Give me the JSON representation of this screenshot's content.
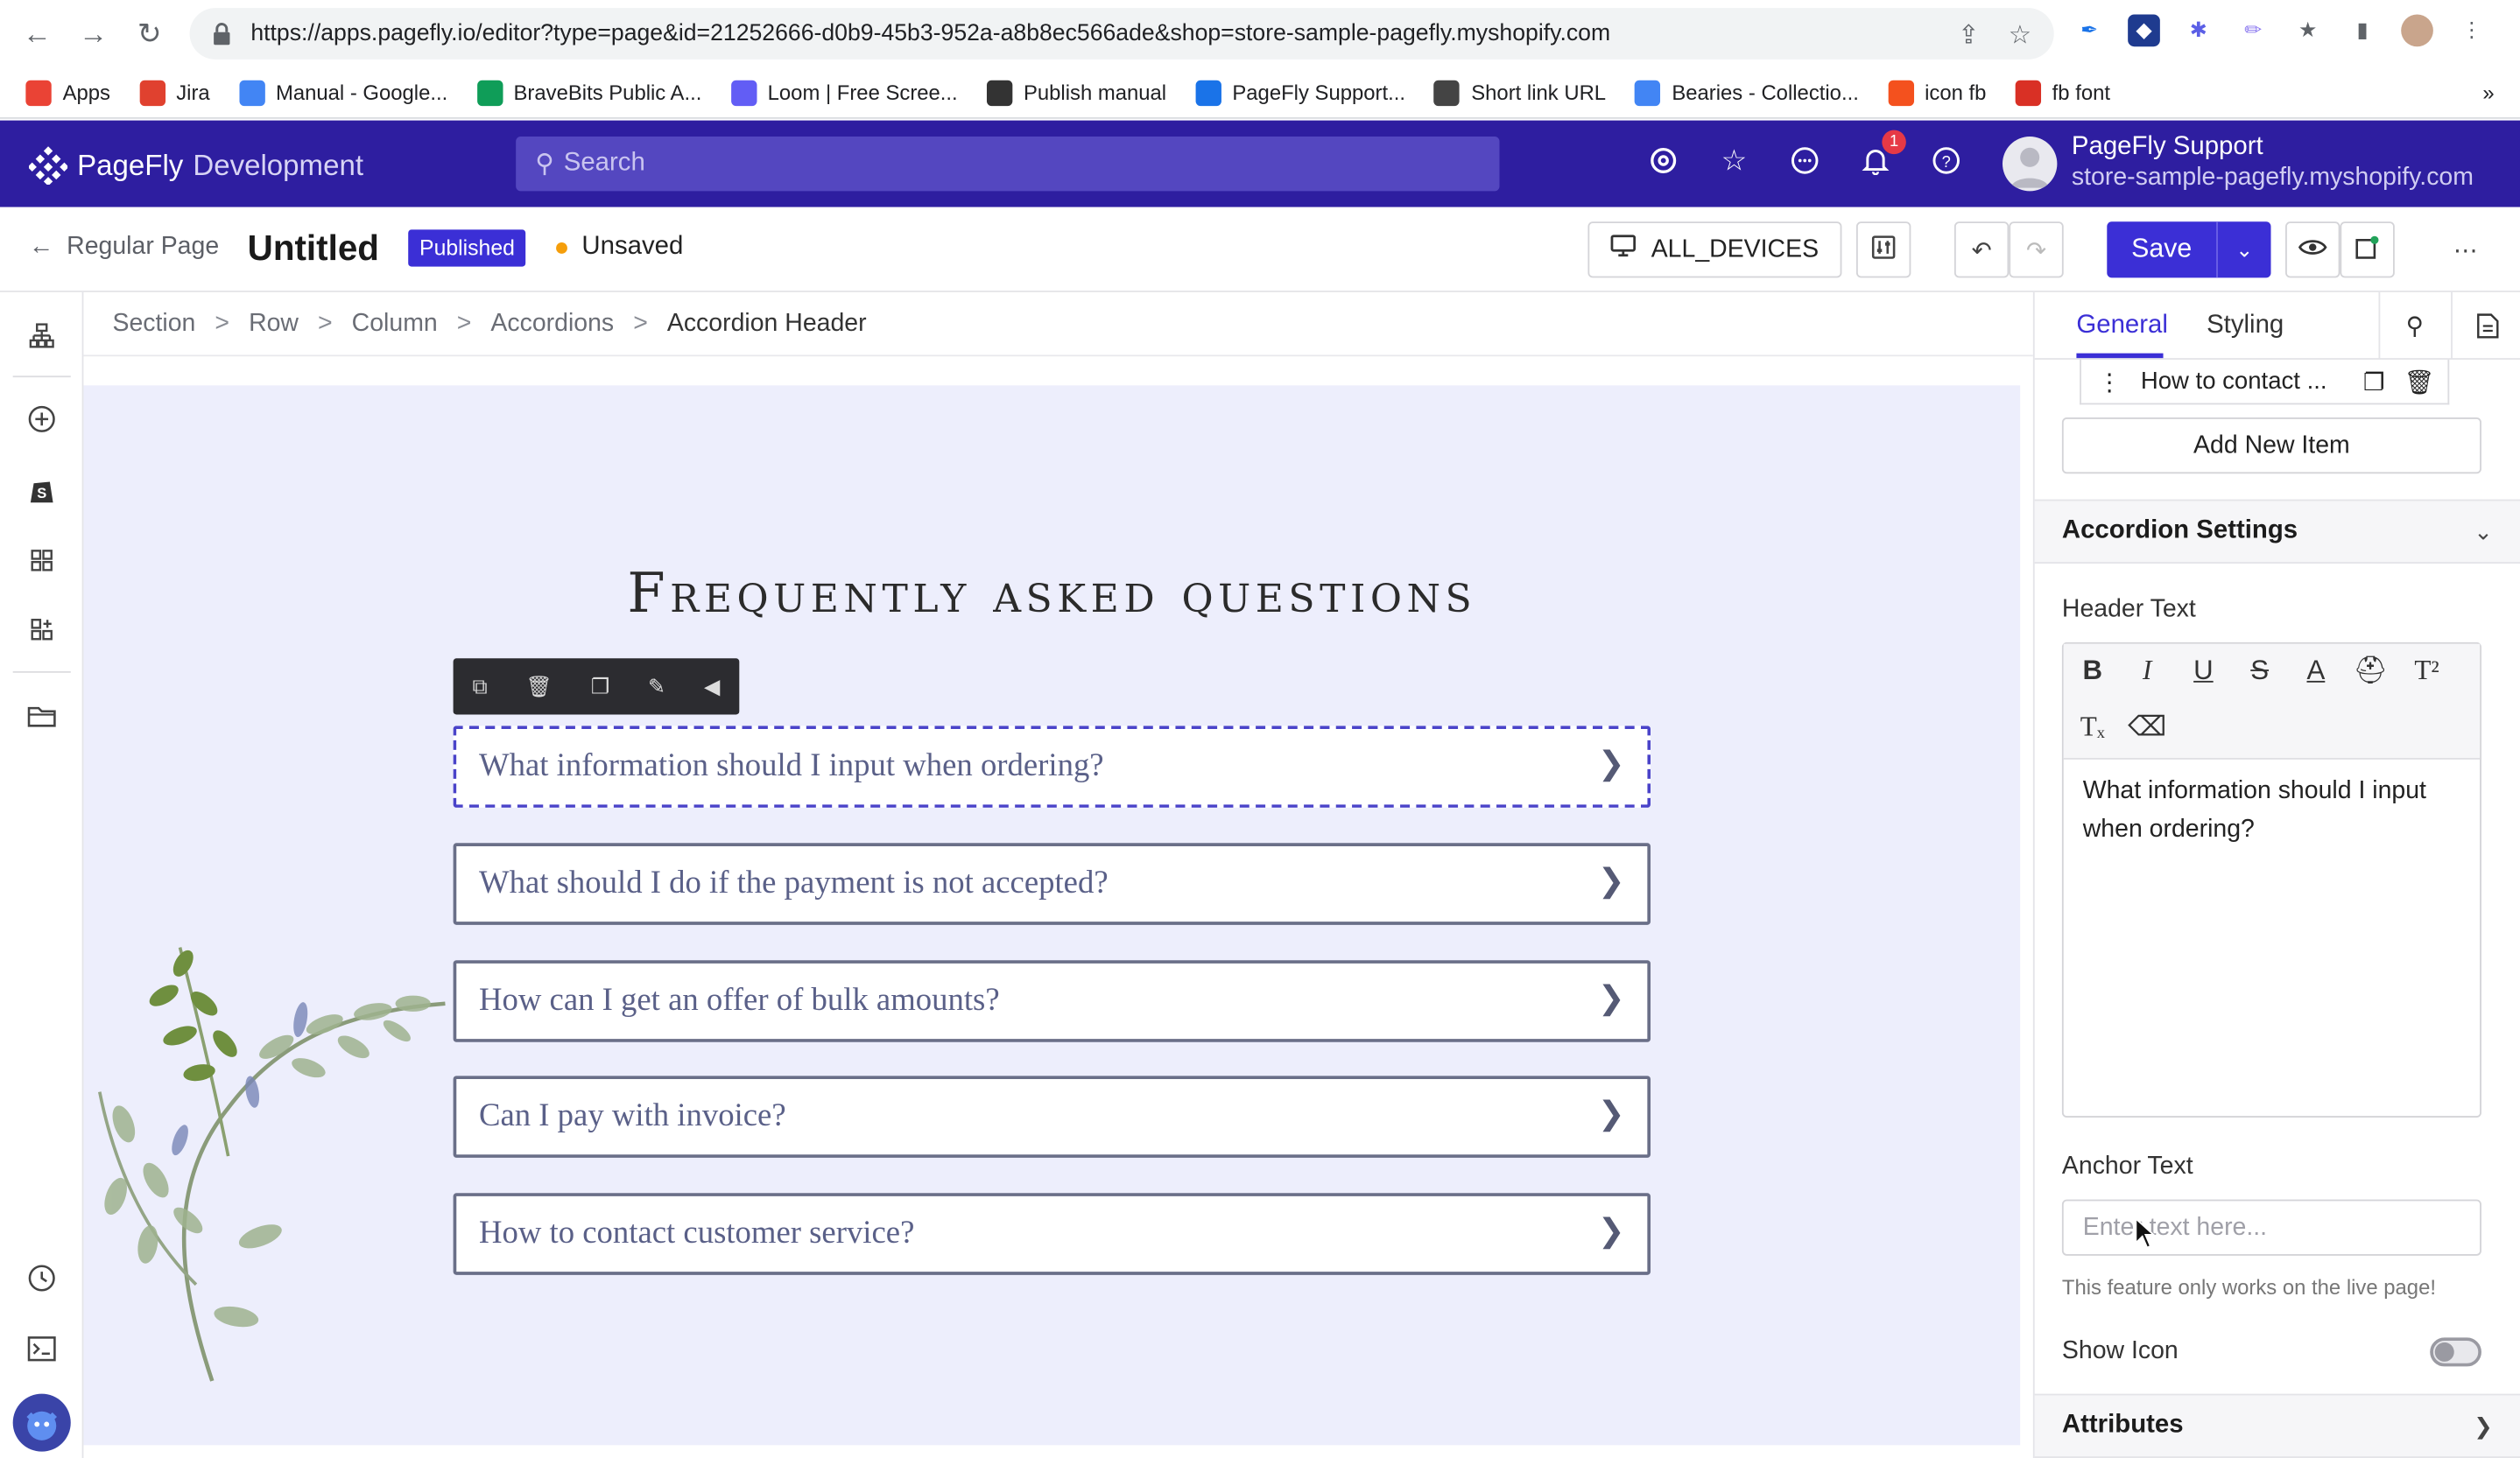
{
  "browser": {
    "url": "https://apps.pagefly.io/editor?type=page&id=21252666-d0b9-45b3-952a-a8b8ec566ade&shop=store-sample-pagefly.myshopify.com",
    "bookmarks": [
      {
        "label": "Apps",
        "color": "#ea4335"
      },
      {
        "label": "Jira",
        "color": "#e0412f"
      },
      {
        "label": "Manual - Google...",
        "color": "#4285f4"
      },
      {
        "label": "BraveBits Public A...",
        "color": "#0f9d58"
      },
      {
        "label": "Loom | Free Scree...",
        "color": "#625df5"
      },
      {
        "label": "Publish manual",
        "color": "#333333"
      },
      {
        "label": "PageFly Support...",
        "color": "#1a73e8"
      },
      {
        "label": "Short link URL",
        "color": "#444444"
      },
      {
        "label": "Bearies - Collectio...",
        "color": "#4285f4"
      },
      {
        "label": "icon fb",
        "color": "#f4511e"
      },
      {
        "label": "fb font",
        "color": "#d93025"
      }
    ]
  },
  "header": {
    "logo": "PageFly",
    "env": "Development",
    "search_placeholder": "Search",
    "notification_count": "1",
    "user_name": "PageFly Support",
    "user_shop": "store-sample-pagefly.myshopify.com",
    "brand_color": "#2e1ea0"
  },
  "toolbar": {
    "back_label": "Regular Page",
    "page_title": "Untitled",
    "status_badge": "Published",
    "save_state": "Unsaved",
    "device_label": "ALL_DEVICES",
    "save_label": "Save"
  },
  "breadcrumb": [
    "Section",
    "Row",
    "Column",
    "Accordions",
    "Accordion Header"
  ],
  "canvas": {
    "title": "Frequently asked questions",
    "accordions": [
      "What information should I input when ordering?",
      "What should I do if the payment is not accepted?",
      "How can I get an offer of bulk amounts?",
      "Can I pay with invoice?",
      "How to contact customer service?"
    ]
  },
  "panel": {
    "tab_general": "General",
    "tab_styling": "Styling",
    "item_partial": "How to contact ...",
    "add_item": "Add New Item",
    "accordion_settings": "Accordion Settings",
    "header_text_label": "Header Text",
    "header_text_value": "What information should I input when ordering?",
    "anchor_text_label": "Anchor Text",
    "anchor_placeholder": "Enter text here...",
    "anchor_hint": "This feature only works on the live page!",
    "show_icon_label": "Show Icon",
    "attributes": "Attributes"
  }
}
